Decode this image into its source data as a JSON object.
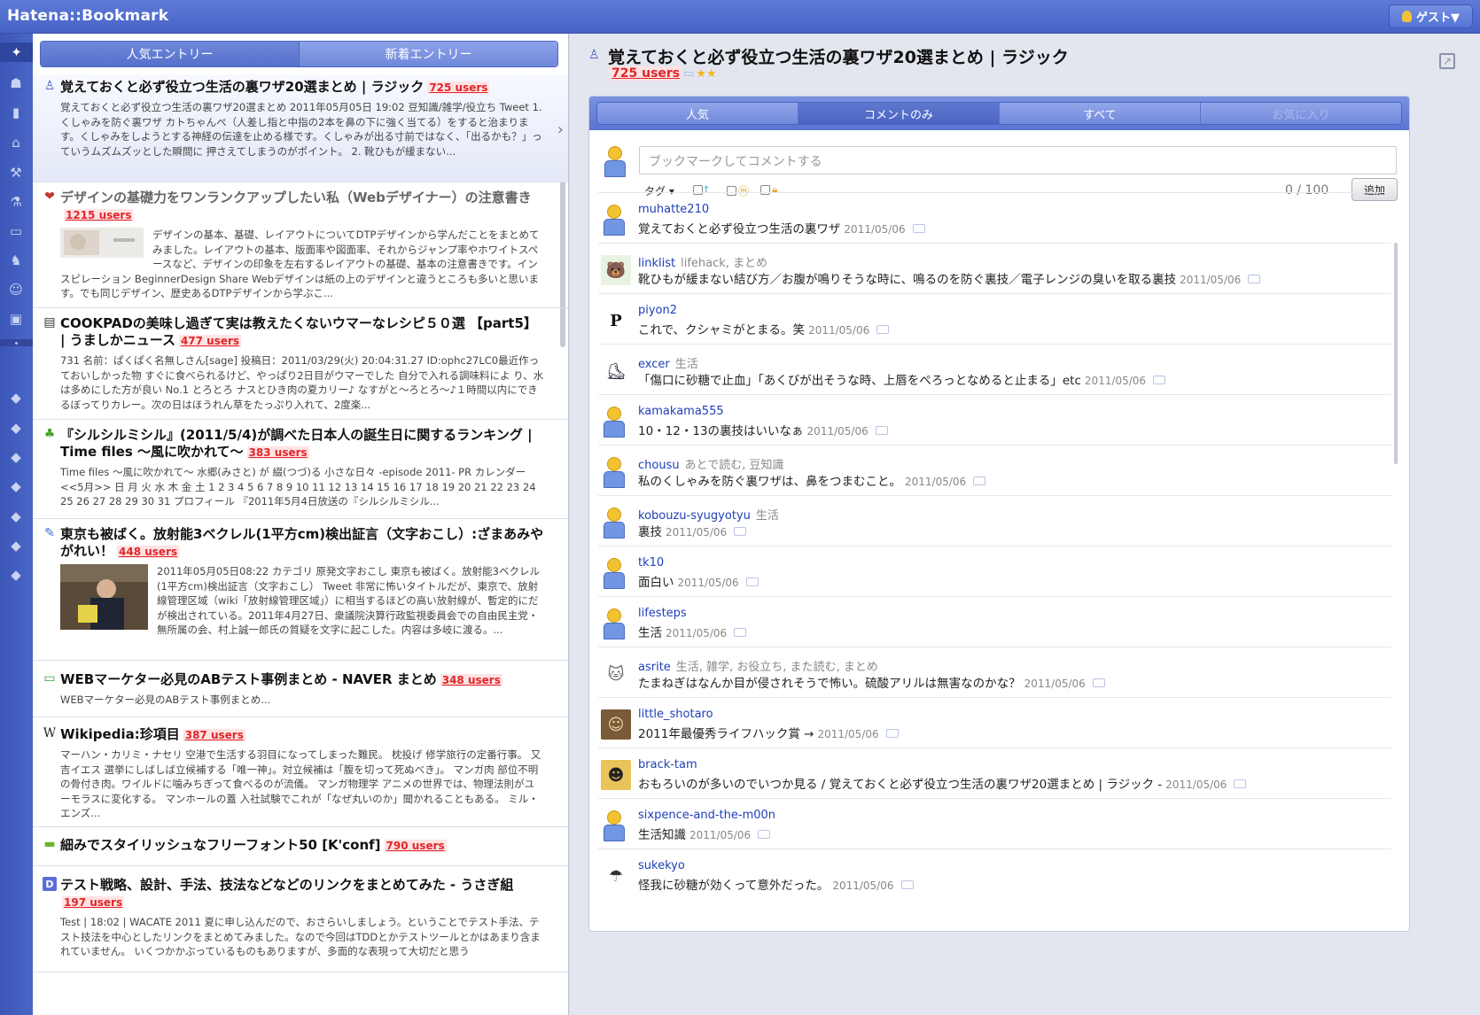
{
  "app": {
    "title": "Hatena::Bookmark",
    "guest_label": "ゲスト▼"
  },
  "left_tabs": [
    "人気エントリー",
    "新着エントリー"
  ],
  "entries": [
    {
      "icon": "♙",
      "title": "覚えておくと必ず役立つ生活の裏ワザ20選まとめ | ラジック",
      "users": "725 users",
      "desc": "覚えておくと必ず役立つ生活の裏ワザ20選まとめ 2011年05月05日 19:02 豆知識/雑学/役立ち Tweet 1. くしゃみを防ぐ裏ワザ カトちゃんぺ（人差し指と中指の2本を鼻の下に強く当てる）をすると治まります。くしゃみをしようとする神経の伝達を止める様です。くしゃみが出る寸前ではなく、「出るかも？」っていうムズムズッとした瞬間に 押さえてしまうのがポイント。 2. 靴ひもが緩まない..."
    },
    {
      "icon": "❤",
      "title": "デザインの基礎力をワンランクアップしたい私（Webデザイナー）の注意書き",
      "users": "1215 users",
      "desc": "デザインの基本、基礎、レイアウトについてDTPデザインから学んだことをまとめてみました。レイアウトの基本、版面率や図面率、それからジャンプ率やホワイトスペースなど、デザインの印象を左右するレイアウトの基礎、基本の注意書きです。インスピレーション BeginnerDesign Share Webデザインは紙の上のデザインと違うところも多いと思います。でも同じデザイン、歴史あるDTPデザインから学ぶこ..."
    },
    {
      "icon": "▤",
      "title": "COOKPADの美味し過ぎて実は教えたくないウマーなレシピ５０選 【part5】 | うましかニュース",
      "users": "477 users",
      "desc": "731 名前：ぱくぱく名無しさん[sage] 投稿日：2011/03/29(火) 20:04:31.27 ID:ophc27LC0最近作っておいしかった物 すぐに食べられるけど、やっぱり2日目がウマーでした 自分で入れる調味料によ り、水は多めにした方が良い No.1 とろとろ ナスとひき肉の夏カリー♪ なすがと～ろとろ～♪１時間以内にできるぼってりカレー。次の日はほうれん草をたっぷり入れて、2度楽..."
    },
    {
      "icon": "♣",
      "title": "『シルシルミシル』(2011/5/4)が調べた日本人の誕生日に関するランキング | Time files 〜風に吹かれて〜",
      "users": "383 users",
      "desc": "Time files 〜風に吹かれて〜 水郷(みさと) が 綴(つづ)る 小さな日々 -episode 2011- PR カレンダー <<5月>> 日 月 火 水 木 金 土 1 2 3 4 5 6 7 8 9 10 11 12 13 14 15 16 17 18 19 20 21 22 23 24 25 26 27 28 29 30 31 プロフィール 『2011年5月4日放送の『シルシルミシル..."
    },
    {
      "icon": "✎",
      "title": "東京も被ばく。放射能3ベクレル(1平方cm)検出証言（文字おこし）:ざまあみやがれい！",
      "users": "448 users",
      "desc": "2011年05月05日08:22 カテゴリ 原発文字おこし 東京も被ばく。放射能3ベクレル(1平方cm)検出証言（文字おこし） Tweet 非常に怖いタイトルだが、東京で、放射線管理区域（wiki「放射線管理区域」）に相当するほどの高い放射線が、暫定的にだが検出されている。2011年4月27日、衆議院決算行政監視委員会での自由民主党・無所属の会、村上誠一郎氏の質疑を文字に起こした。内容は多岐に渡る。..."
    },
    {
      "icon": "▭",
      "title": "WEBマーケター必見のABテスト事例まとめ - NAVER まとめ",
      "users": "348 users",
      "desc": "WEBマーケター必見のABテスト事例まとめ..."
    },
    {
      "icon": "W",
      "title": "Wikipedia:珍項目",
      "users": "387 users",
      "desc": "マーハン・カリミ・ナセリ 空港で生活する羽目になってしまった難民。 枕投げ 修学旅行の定番行事。 又吉イエス 選挙にしばしば立候補する「唯一神」。対立候補は「腹を切って死ぬべき」。 マンガ肉 部位不明の骨付き肉。ワイルドに噛みちぎって食べるのが流儀。 マンガ物理学 アニメの世界では、物理法則がユーモラスに変化する。 マンホールの蓋 入社試験でこれが「なぜ丸いのか」聞かれることもある。 ミル・エンズ..."
    },
    {
      "icon": "▬",
      "title": "細みでスタイリッシュなフリーフォント50 [K'conf]",
      "users": "790 users",
      "desc": ""
    },
    {
      "icon": "D",
      "title": "テスト戦略、設計、手法、技法などなどのリンクをまとめてみた - うさぎ組",
      "users": "197 users",
      "desc": "Test | 18:02 | WACATE 2011 夏に申し込んだので、おさらいしましょう。ということでテスト手法、テスト技法を中心としたリンクをまとめてみました。なので今回はTDDとかテストツールとかはあまり含まれていません。 いくつかかぶっているものもありますが、多面的な表現って大切だと思う"
    }
  ],
  "detail": {
    "title": "覚えておくと必ず役立つ生活の裏ワザ20選まとめ | ラジック",
    "users": "725 users",
    "stars": "★★",
    "tabs": [
      "人気",
      "コメントのみ",
      "すべて",
      "お気に入り"
    ],
    "comment_placeholder": "ブックマークしてコメントする",
    "tag_label": "タグ ▾",
    "counter": "0 / 100",
    "add_label": "追加"
  },
  "comments": [
    {
      "user": "muhatte210",
      "tags": "",
      "text": "覚えておくと必ず役立つ生活の裏ワザ",
      "date": "2011/05/06",
      "avatar": "default"
    },
    {
      "user": "linklist",
      "tags": "lifehack, まとめ",
      "text": "靴ひもが緩まない結び方／お腹が鳴りそうな時に、鳴るのを防ぐ裏技／電子レンジの臭いを取る裏技",
      "date": "2011/05/06",
      "avatar": "🐻"
    },
    {
      "user": "piyon2",
      "tags": "",
      "text": "これで、クシャミがとまる。笑",
      "date": "2011/05/06",
      "avatar": "P"
    },
    {
      "user": "excer",
      "tags": "生活",
      "text": "「傷口に砂糖で止血」「あくびが出そうな時、上唇をぺろっとなめると止まる」etc",
      "date": "2011/05/06",
      "avatar": "⛸"
    },
    {
      "user": "kamakama555",
      "tags": "",
      "text": "10・12・13の裏技はいいなぁ",
      "date": "2011/05/06",
      "avatar": "default"
    },
    {
      "user": "chousu",
      "tags": "あとで読む, 豆知識",
      "text": "私のくしゃみを防ぐ裏ワザは、鼻をつまむこと。",
      "date": "2011/05/06",
      "avatar": "default"
    },
    {
      "user": "kobouzu-syugyotyu",
      "tags": "生活",
      "text": "裏技",
      "date": "2011/05/06",
      "avatar": "default"
    },
    {
      "user": "tk10",
      "tags": "",
      "text": "面白い",
      "date": "2011/05/06",
      "avatar": "default"
    },
    {
      "user": "lifesteps",
      "tags": "",
      "text": "生活",
      "date": "2011/05/06",
      "avatar": "default"
    },
    {
      "user": "asrite",
      "tags": "生活, 雑学, お役立ち, また読む, まとめ",
      "text": "たまねぎはなんか目が侵されそうで怖い。硫酸アリルは無害なのかな？",
      "date": "2011/05/06",
      "avatar": "🐱"
    },
    {
      "user": "little_shotaro",
      "tags": "",
      "text": "2011年最優秀ライフハック賞 →",
      "date": "2011/05/06",
      "avatar": "☺"
    },
    {
      "user": "brack-tam",
      "tags": "",
      "text": "おもろいのが多いのでいつか見る / 覚えておくと必ず役立つ生活の裏ワザ20選まとめ | ラジック -",
      "date": "2011/05/06",
      "avatar": "☻"
    },
    {
      "user": "sixpence-and-the-m00n",
      "tags": "",
      "text": "生活知識",
      "date": "2011/05/06",
      "avatar": "default"
    },
    {
      "user": "sukekyo",
      "tags": "",
      "text": "怪我に砂糖が効くって意外だった。",
      "date": "2011/05/06",
      "avatar": "☂"
    }
  ],
  "colors": {
    "brand": "#4763c6",
    "users_red": "#e0262a",
    "user_link": "#1e3fb8"
  }
}
